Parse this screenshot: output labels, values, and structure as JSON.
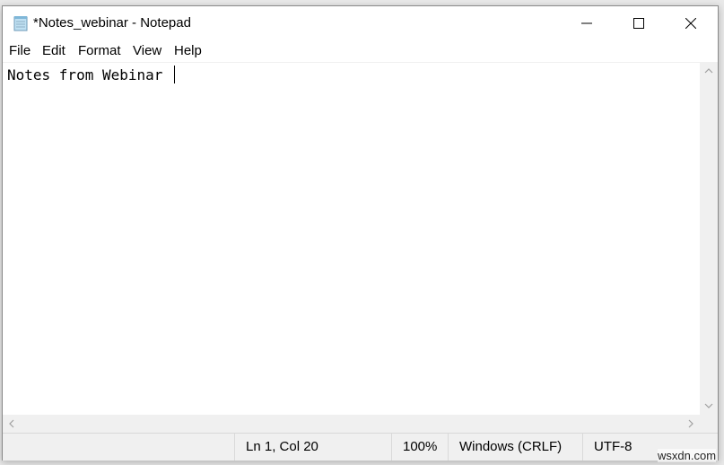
{
  "window": {
    "title": "*Notes_webinar - Notepad",
    "icon": "notepad-icon",
    "controls": {
      "minimize": "minimize-icon",
      "maximize": "maximize-icon",
      "close": "close-icon"
    }
  },
  "menu": {
    "items": [
      {
        "label": "File"
      },
      {
        "label": "Edit"
      },
      {
        "label": "Format"
      },
      {
        "label": "View"
      },
      {
        "label": "Help"
      }
    ]
  },
  "editor": {
    "content": "Notes from Webinar "
  },
  "scrollbars": {
    "up": "chevron-up-icon",
    "down": "chevron-down-icon",
    "left": "chevron-left-icon",
    "right": "chevron-right-icon"
  },
  "status": {
    "position": "Ln 1, Col 20",
    "zoom": "100%",
    "line_ending": "Windows (CRLF)",
    "encoding": "UTF-8"
  },
  "watermark": "wsxdn.com"
}
